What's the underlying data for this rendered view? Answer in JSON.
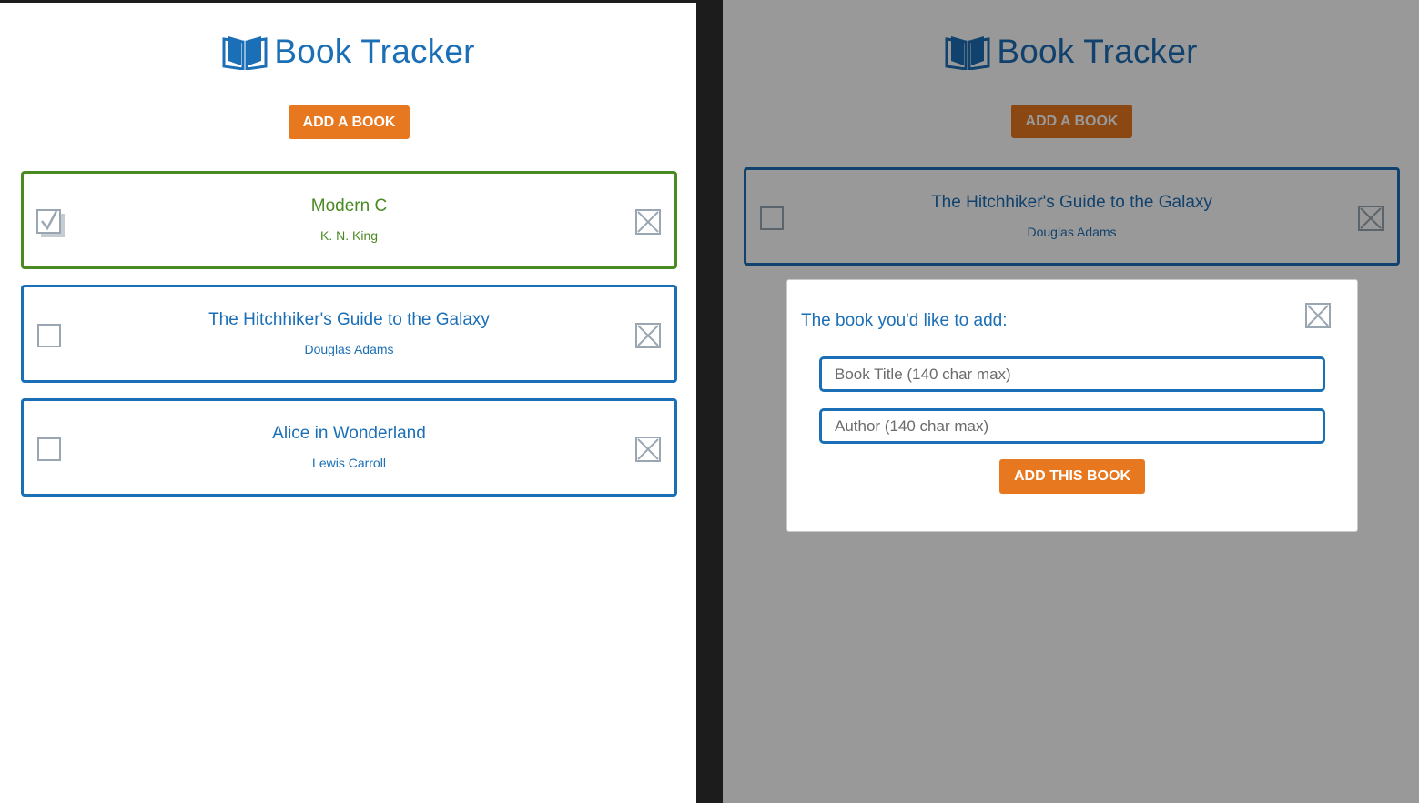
{
  "app": {
    "title": "Book Tracker",
    "add_button": "ADD A BOOK"
  },
  "colors": {
    "brand_blue": "#1b6fb6",
    "done_green": "#4a8a22",
    "accent_orange": "#e87820"
  },
  "left_view": {
    "books": [
      {
        "title": "Modern C",
        "author": "K. N. King",
        "read": true
      },
      {
        "title": "The Hitchhiker's Guide to the Galaxy",
        "author": "Douglas Adams",
        "read": false
      },
      {
        "title": "Alice in Wonderland",
        "author": "Lewis Carroll",
        "read": false
      }
    ]
  },
  "right_view": {
    "books": [
      {
        "title": "The Hitchhiker's Guide to the Galaxy",
        "author": "Douglas Adams",
        "read": false
      }
    ],
    "modal": {
      "prompt": "The book you'd like to add:",
      "title_placeholder": "Book Title (140 char max)",
      "author_placeholder": "Author (140 char max)",
      "submit": "ADD THIS BOOK"
    }
  },
  "icons": {
    "logo": "open-book-icon",
    "checkbox": "checkbox-icon",
    "checked": "checked-box-icon",
    "delete": "delete-x-box-icon"
  }
}
